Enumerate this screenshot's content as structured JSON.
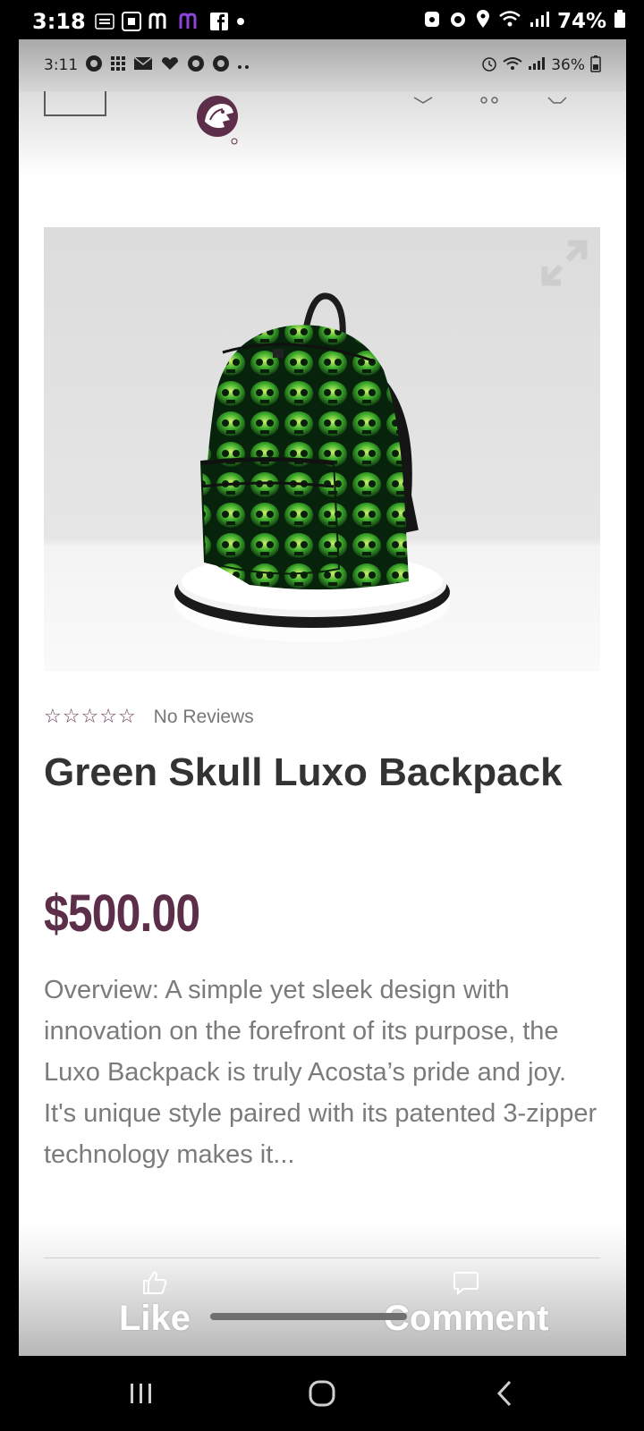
{
  "outer_status": {
    "time": "3:18",
    "battery": "74%"
  },
  "inner_status": {
    "time": "3:11",
    "battery": "36%"
  },
  "product": {
    "review_text": "No Reviews",
    "rating_stars": 0,
    "rating_max": 5,
    "title": "Green Skull Luxo Backpack",
    "price": "$500.00",
    "description": "Overview: A simple yet sleek design with innovation on the forefront of its purpose, the Luxo Backpack is truly Acosta’s pride and joy. It's unique style paired with its patented 3-zipper technology makes it..."
  },
  "facebook_bar": {
    "like_label": "Like",
    "comment_label": "Comment"
  },
  "colors": {
    "price": "#5d2e4a",
    "stars": "#6b3b58",
    "backpack_green": "#3fae2c"
  },
  "icons": {
    "expand": "expand-icon",
    "like": "thumbs-up-icon",
    "comment": "comment-icon"
  }
}
